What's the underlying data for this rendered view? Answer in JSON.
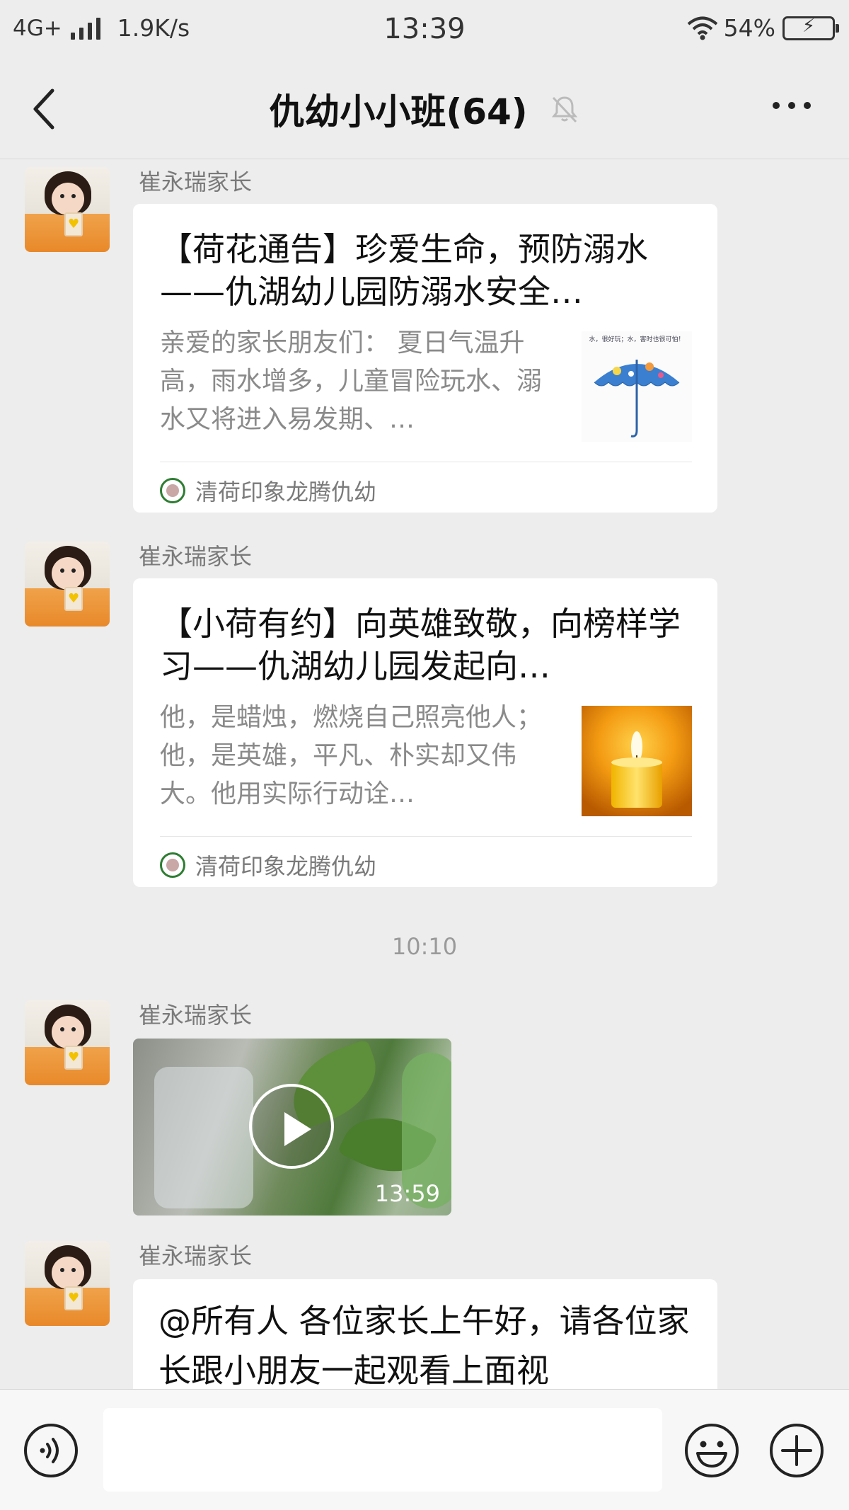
{
  "status_bar": {
    "network": "4G+",
    "speed": "1.9K/s",
    "time": "13:39",
    "battery": "54%"
  },
  "nav": {
    "title": "仇幼小小班(64)",
    "icons": [
      "back-arrow-icon",
      "bell-muted-icon",
      "more-icon"
    ]
  },
  "messages": [
    {
      "sender": "崔永瑞家长",
      "type": "article",
      "title": "【荷花通告】珍爱生命，预防溺水——仇湖幼儿园防溺水安全…",
      "description": "亲爱的家长朋友们： 夏日气温升高，雨水增多，儿童冒险玩水、溺水又将进入易发期、…",
      "thumbnail_caption": "水，很好玩；水，害时也很可怕！",
      "source": "清荷印象龙腾仇幼"
    },
    {
      "sender": "崔永瑞家长",
      "type": "article",
      "title": "【小荷有约】向英雄致敬，向榜样学习——仇湖幼儿园发起向…",
      "description": "他，是蜡烛，燃烧自己照亮他人；他，是英雄，平凡、朴实却又伟大。他用实际行动诠…",
      "thumbnail": "candle-image",
      "source": "清荷印象龙腾仇幼"
    },
    {
      "type": "timestamp",
      "text": "10:10"
    },
    {
      "sender": "崔永瑞家长",
      "type": "video",
      "duration": "13:59"
    },
    {
      "sender": "崔永瑞家长",
      "type": "text",
      "text": "@所有人    各位家长上午好，请各位家长跟小朋友一起观看上面视"
    }
  ],
  "input_bar": {
    "icons": [
      "voice-icon",
      "emoji-icon",
      "plus-icon"
    ]
  },
  "colors": {
    "background": "#ededed",
    "bubble": "#ffffff",
    "sender_text": "#7a7a7a",
    "source_logo": "#2e7d32"
  }
}
